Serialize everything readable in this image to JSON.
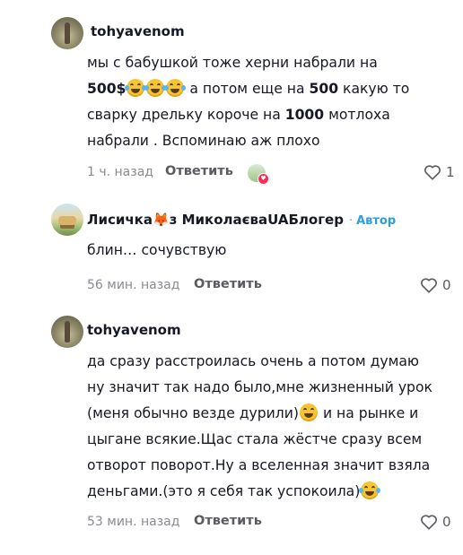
{
  "comments": [
    {
      "username": "tohyavenom",
      "avatar": "olive-figure-avatar",
      "lines": [
        {
          "parts": [
            {
              "t": "мы с бабушкой тоже херни набрали на"
            }
          ]
        },
        {
          "parts": [
            {
              "t": "500$",
              "bold": true
            },
            {
              "emoji": "tears-of-joy"
            },
            {
              "emoji": "tears-of-joy"
            },
            {
              "emoji": "tears-of-joy"
            },
            {
              "t": " а потом еще на "
            },
            {
              "t": "500",
              "bold": true
            },
            {
              "t": " какую то"
            }
          ]
        },
        {
          "parts": [
            {
              "t": "сварку дрельку короче на "
            },
            {
              "t": "1000",
              "bold": true
            },
            {
              "t": " мотлоха"
            }
          ]
        },
        {
          "parts": [
            {
              "t": "набрали . Вспоминаю аж плохо"
            }
          ]
        }
      ],
      "time": "1 ч. назад",
      "reply_label": "Ответить",
      "like_count": "1",
      "has_creator_like": true
    },
    {
      "username": "Лисичка",
      "username_fox": "🦊",
      "username_rest": "з МиколаєваUAБлогер",
      "badge_label": "Автор",
      "avatar": "landscape-avatar",
      "lines": [
        {
          "parts": [
            {
              "t": "блин… сочувствую"
            }
          ]
        }
      ],
      "time": "56 мин. назад",
      "reply_label": "Ответить",
      "like_count": "0"
    },
    {
      "username": "tohyavenom",
      "avatar": "olive-figure-avatar",
      "lines": [
        {
          "parts": [
            {
              "t": "да сразу расстроилась очень а потом думаю"
            }
          ]
        },
        {
          "parts": [
            {
              "t": "ну значит так надо было,мне жизненный урок"
            }
          ]
        },
        {
          "parts": [
            {
              "t": "(меня обычно везде дурили)"
            },
            {
              "emoji": "grin"
            },
            {
              "t": " и на рынке и"
            }
          ]
        },
        {
          "parts": [
            {
              "t": "цыгане всякие.Щас стала жёстче сразу всем"
            }
          ]
        },
        {
          "parts": [
            {
              "t": "отворот поворот.Ну а вселенная значит взяла"
            }
          ]
        },
        {
          "parts": [
            {
              "t": "деньгами.(это я себя так успокоила)"
            },
            {
              "emoji": "tears-of-joy"
            }
          ]
        }
      ],
      "time": "53 мин. назад",
      "reply_label": "Ответить",
      "like_count": "0"
    }
  ],
  "colors": {
    "text": "#161823",
    "meta": "#8a8b91",
    "author_badge": "#2a9fd8",
    "emoji": "#f7c531",
    "heart_badge": "#fe2c55"
  }
}
